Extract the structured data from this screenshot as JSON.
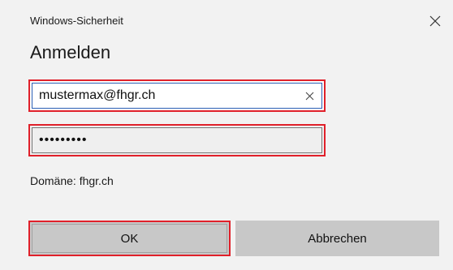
{
  "dialog": {
    "window_title": "Windows-Sicherheit",
    "heading": "Anmelden",
    "close_icon": "close-icon",
    "email": {
      "value": "mustermax@fhgr.ch",
      "clear_icon": "clear-x-icon"
    },
    "password": {
      "masked_value": "•••••••••"
    },
    "domain_label": "Domäne: fhgr.ch",
    "buttons": {
      "ok_label": "OK",
      "cancel_label": "Abbrechen"
    }
  },
  "colors": {
    "highlight_border": "#e0202a",
    "focus_border": "#2b5fb4",
    "dialog_background": "#f2f2f2",
    "button_background": "#c8c8c8"
  }
}
